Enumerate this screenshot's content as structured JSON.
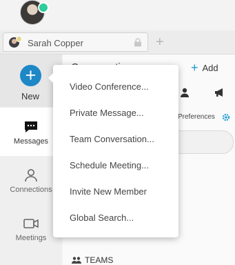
{
  "tab": {
    "label": "Sarah Copper"
  },
  "nav": {
    "new_label": "New",
    "items": [
      {
        "label": "Messages"
      },
      {
        "label": "Connections"
      },
      {
        "label": "Meetings"
      }
    ]
  },
  "main": {
    "title": "Conversations",
    "add_label": "Add",
    "preferences_label": "Preferences",
    "teams_label": "TEAMS"
  },
  "menu": {
    "items": [
      "Video Conference...",
      "Private Message...",
      "Team Conversation...",
      "Schedule Meeting...",
      "Invite New Member",
      "Global Search..."
    ]
  },
  "colors": {
    "accent": "#1e88c7",
    "presence": "#2ecc9a",
    "gear": "#1e9bd7"
  }
}
